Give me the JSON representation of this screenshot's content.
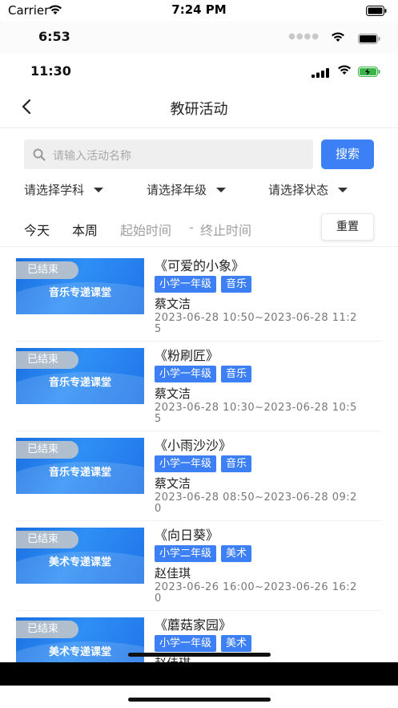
{
  "status_bars": {
    "carrier": "Carrier",
    "time_top": "7:24 PM",
    "time_second": "6:53",
    "time_third": "11:30"
  },
  "nav": {
    "title": "教研活动",
    "back_icon": "chevron-left-icon"
  },
  "search": {
    "placeholder": "请输入活动名称",
    "button": "搜索"
  },
  "filters": {
    "subject": "请选择学科",
    "grade": "请选择年级",
    "status": "请选择状态"
  },
  "date_filter": {
    "today": "今天",
    "week": "本周",
    "start_placeholder": "起始时间",
    "separator": "-",
    "end_placeholder": "终止时间",
    "reset": "重置"
  },
  "activities": [
    {
      "status": "已结束",
      "thumb_label": "音乐专递课堂",
      "title": "《可爱的小象》",
      "grade": "小学一年级",
      "subject": "音乐",
      "teacher": "蔡文洁",
      "time": "2023-06-28 10:50~2023-06-28 11:25"
    },
    {
      "status": "已结束",
      "thumb_label": "音乐专递课堂",
      "title": "《粉刷匠》",
      "grade": "小学一年级",
      "subject": "音乐",
      "teacher": "蔡文洁",
      "time": "2023-06-28 10:30~2023-06-28 10:55"
    },
    {
      "status": "已结束",
      "thumb_label": "音乐专递课堂",
      "title": "《小雨沙沙》",
      "grade": "小学一年级",
      "subject": "音乐",
      "teacher": "蔡文洁",
      "time": "2023-06-28 08:50~2023-06-28 09:20"
    },
    {
      "status": "已结束",
      "thumb_label": "美术专递课堂",
      "title": "《向日葵》",
      "grade": "小学二年级",
      "subject": "美术",
      "teacher": "赵佳琪",
      "time": "2023-06-26 16:00~2023-06-26 16:20"
    },
    {
      "status": "已结束",
      "thumb_label": "美术专递课堂",
      "title": "《蘑菇家园》",
      "grade": "小学一年级",
      "subject": "美术",
      "teacher": "赵佳琪",
      "time": ""
    }
  ],
  "colors": {
    "accent": "#3d80f5",
    "thumb_blue": "#1f74e8"
  }
}
